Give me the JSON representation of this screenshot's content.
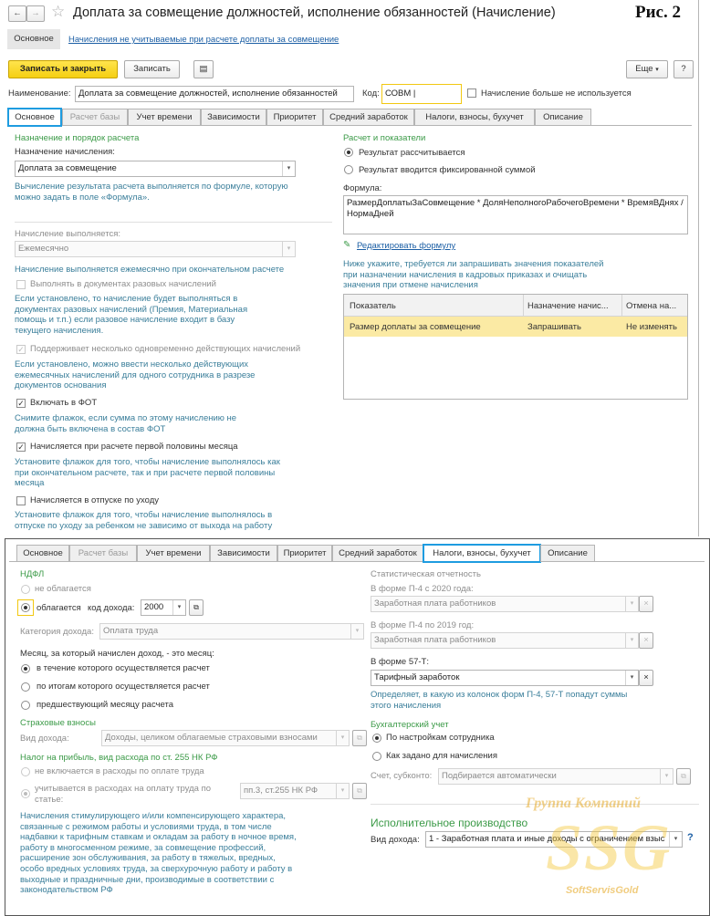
{
  "window": {
    "title": "Доплата за совмещение должностей, исполнение обязанностей (Начисление)",
    "ris": "Рис. 2"
  },
  "nav": {
    "main_tab": "Основное",
    "link": "Начисления не учитываемые при расчете доплаты за совмещение"
  },
  "toolbar": {
    "save_close": "Записать и закрыть",
    "save": "Записать",
    "more": "Еще",
    "help": "?"
  },
  "header": {
    "name_label": "Наименование:",
    "name_value": "Доплата за совмещение должностей, исполнение обязанностей",
    "code_label": "Код:",
    "code_value": "СОВМ",
    "unused_label": "Начисление больше не используется"
  },
  "tabs": [
    "Основное",
    "Расчет базы",
    "Учет времени",
    "Зависимости",
    "Приоритет",
    "Средний заработок",
    "Налоги, взносы, бухучет",
    "Описание"
  ],
  "main": {
    "purpose_header": "Назначение и порядок расчета",
    "purpose_label": "Назначение начисления:",
    "purpose_value": "Доплата за совмещение",
    "purpose_desc": "Вычисление результата расчета выполняется по формуле, которую можно задать в поле «Формула».",
    "exec_label": "Начисление выполняется:",
    "exec_value": "Ежемесячно",
    "exec_desc": "Начисление выполняется ежемесячно при окончательном расчете",
    "one_time_label": "Выполнять в документах разовых начислений",
    "one_time_desc": "Если установлено, то начисление будет выполняться в документах разовых начислений (Премия, Материальная помощь и т.п.) если разовое начисление входит в базу текущего начисления.",
    "multi_label": "Поддерживает несколько одновременно действующих начислений",
    "multi_desc": "Если установлено, можно ввести несколько действующих ежемесячных начислений для одного сотрудника в разрезе документов основания",
    "fot_label": "Включать в ФОТ",
    "fot_desc": "Снимите флажок, если сумма по этому начислению не должна быть включена в состав ФОТ",
    "half_label": "Начисляется при расчете первой половины месяца",
    "half_desc": "Установите флажок для того, чтобы начисление выполнялось как при окончательном расчете, так и при расчете первой половины месяца",
    "leave_label": "Начисляется в отпуске по уходу",
    "leave_desc": "Установите флажок для того, чтобы начисление выполнялось в отпуске по уходу за ребенком не зависимо от выхода на работу",
    "calc_header": "Расчет и показатели",
    "calc_opt1": "Результат рассчитывается",
    "calc_opt2": "Результат вводится фиксированной суммой",
    "formula_label": "Формула:",
    "formula_value": "РазмерДоплатыЗаСовмещение * ДоляНеполногоРабочегоВремени * ВремяВДнях / НормаДней",
    "edit_formula": "Редактировать формулу",
    "indicators_desc": "Ниже укажите, требуется ли запрашивать значения показателей при назначении начисления в кадровых приказах и очищать значения при отмене начисления",
    "table_headers": [
      "Показатель",
      "Назначение начис...",
      "Отмена на..."
    ],
    "table_row": [
      "Размер доплаты за совмещение",
      "Запрашивать",
      "Не изменять"
    ]
  },
  "taxes": {
    "ndfl_header": "НДФЛ",
    "ndfl_opt1": "не облагается",
    "ndfl_opt2": "облагается",
    "income_code_label": "код дохода:",
    "income_code": "2000",
    "income_cat_label": "Категория дохода:",
    "income_cat": "Оплата труда",
    "month_label": "Месяц, за который начислен доход, - это месяц:",
    "month_opt1": "в течение которого осуществляется расчет",
    "month_opt2": "по итогам которого осуществляется расчет",
    "month_opt3": "предшествующий месяцу расчета",
    "ins_header": "Страховые взносы",
    "ins_label": "Вид дохода:",
    "ins_value": "Доходы, целиком облагаемые страховыми взносами",
    "profit_header": "Налог на прибыль, вид расхода по ст. 255 НК РФ",
    "profit_opt1": "не включается в расходы по оплате труда",
    "profit_opt2": "учитывается в расходах на оплату труда по статье:",
    "profit_value": "пп.3, ст.255 НК РФ",
    "profit_desc": "Начисления стимулирующего и/или компенсирующего характера, связанные с режимом работы и условиями труда, в том числе надбавки к тарифным ставкам и окладам за работу в ночное время, работу в многосменном режиме, за совмещение профессий, расширение зон обслуживания, за работу в тяжелых, вредных, особо вредных условиях труда, за сверхурочную работу и работу в выходные и праздничные дни, производимые в соответствии с законодательством РФ",
    "stat_header": "Статистическая отчетность",
    "p4_2020_label": "В форме П-4 с 2020 года:",
    "p4_2020_value": "Заработная плата работников",
    "p4_2019_label": "В форме П-4 по 2019 год:",
    "p4_2019_value": "Заработная плата работников",
    "f57_label": "В форме 57-Т:",
    "f57_value": "Тарифный заработок",
    "f57_desc": "Определяет, в какую из колонок форм П-4, 57-Т попадут суммы этого начисления",
    "acc_header": "Бухгалтерский учет",
    "acc_opt1": "По настройкам сотрудника",
    "acc_opt2": "Как задано для начисления",
    "acc_account_label": "Счет, субконто:",
    "acc_account_value": "Подбирается автоматически",
    "exec_prod_header": "Исполнительное производство",
    "exec_prod_label": "Вид дохода:",
    "exec_prod_value": "1 - Заработная плата и иные доходы с ограничением взыс"
  },
  "watermark": {
    "line1": "Группа Компаний",
    "logo": "SSG",
    "line2": "SoftServisGold"
  }
}
